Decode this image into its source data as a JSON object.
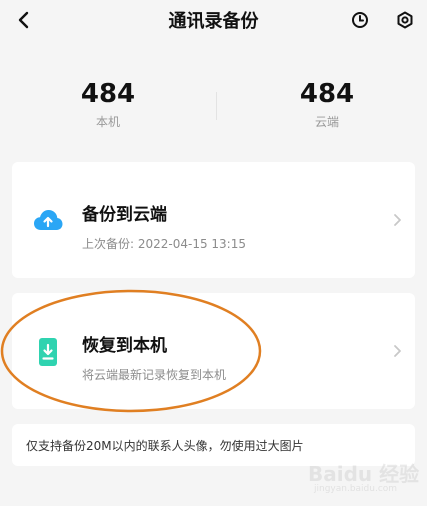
{
  "header": {
    "title": "通讯录备份",
    "back_icon": "back-arrow-icon",
    "history_icon": "clock-icon",
    "settings_icon": "gear-icon"
  },
  "counts": {
    "local": {
      "value": "484",
      "label": "本机"
    },
    "cloud": {
      "value": "484",
      "label": "云端"
    }
  },
  "backup_card": {
    "title": "备份到云端",
    "subtitle": "上次备份: 2022-04-15 13:15",
    "icon": "cloud-upload-icon",
    "icon_color": "#2aa6f5"
  },
  "restore_card": {
    "title": "恢复到本机",
    "subtitle": "将云端最新记录恢复到本机",
    "icon": "phone-download-icon",
    "icon_color": "#2fd3b0"
  },
  "notice": {
    "text": "仅支持备份20M以内的联系人头像，勿使用过大图片"
  },
  "annotation": {
    "shape": "ellipse",
    "color": "#e07f22"
  },
  "watermark": {
    "main": "Baidu 经验",
    "sub": "jingyan.baidu.com"
  }
}
